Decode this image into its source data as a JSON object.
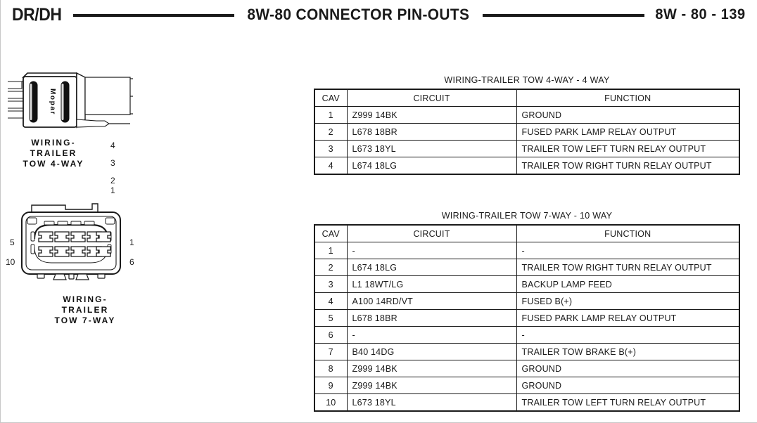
{
  "header": {
    "model_label": "DR/DH",
    "title": "8W-80 CONNECTOR PIN-OUTS",
    "page_ref": "8W - 80 - 139"
  },
  "connectors": [
    {
      "id": "trailer-tow-4-way",
      "body_text": "Mopar",
      "caption_lines": [
        "WIRING-",
        "TRAILER",
        "TOW 4-WAY"
      ],
      "pin_labels": [
        "4",
        "3",
        "2",
        "1"
      ]
    },
    {
      "id": "trailer-tow-7-way",
      "caption_lines": [
        "WIRING-",
        "TRAILER",
        "TOW 7-WAY"
      ],
      "pin_labels": {
        "top_left": "5",
        "bottom_left": "10",
        "top_right": "1",
        "bottom_right": "6"
      }
    }
  ],
  "tables": [
    {
      "title": "WIRING-TRAILER TOW 4-WAY - 4 WAY",
      "columns": [
        "CAV",
        "CIRCUIT",
        "FUNCTION"
      ],
      "rows": [
        {
          "cav": "1",
          "circuit": "Z999 14BK",
          "function": "GROUND"
        },
        {
          "cav": "2",
          "circuit": "L678 18BR",
          "function": "FUSED PARK LAMP RELAY OUTPUT"
        },
        {
          "cav": "3",
          "circuit": "L673 18YL",
          "function": "TRAILER TOW LEFT TURN RELAY OUTPUT"
        },
        {
          "cav": "4",
          "circuit": "L674 18LG",
          "function": "TRAILER TOW RIGHT TURN RELAY OUTPUT"
        }
      ]
    },
    {
      "title": "WIRING-TRAILER TOW 7-WAY - 10 WAY",
      "columns": [
        "CAV",
        "CIRCUIT",
        "FUNCTION"
      ],
      "rows": [
        {
          "cav": "1",
          "circuit": "-",
          "function": "-"
        },
        {
          "cav": "2",
          "circuit": "L674 18LG",
          "function": "TRAILER TOW RIGHT TURN RELAY OUTPUT"
        },
        {
          "cav": "3",
          "circuit": "L1 18WT/LG",
          "function": "BACKUP LAMP FEED"
        },
        {
          "cav": "4",
          "circuit": "A100 14RD/VT",
          "function": "FUSED B(+)"
        },
        {
          "cav": "5",
          "circuit": "L678 18BR",
          "function": "FUSED PARK LAMP RELAY OUTPUT"
        },
        {
          "cav": "6",
          "circuit": "-",
          "function": "-"
        },
        {
          "cav": "7",
          "circuit": "B40 14DG",
          "function": "TRAILER TOW BRAKE B(+)"
        },
        {
          "cav": "8",
          "circuit": "Z999 14BK",
          "function": "GROUND"
        },
        {
          "cav": "9",
          "circuit": "Z999 14BK",
          "function": "GROUND"
        },
        {
          "cav": "10",
          "circuit": "L673 18YL",
          "function": "TRAILER TOW LEFT TURN RELAY OUTPUT"
        }
      ]
    }
  ]
}
